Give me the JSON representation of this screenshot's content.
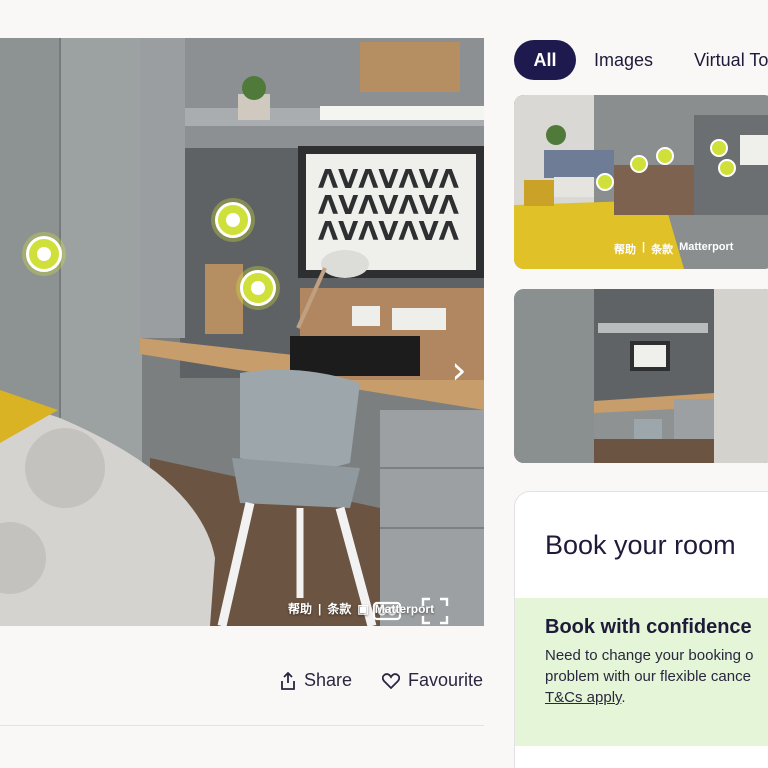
{
  "viewer": {
    "next_arrow": "›",
    "footer": {
      "help": "帮助",
      "separator": "|",
      "terms": "条款",
      "brand": "Matterport"
    }
  },
  "actions": {
    "share_label": "Share",
    "favourite_label": "Favourite"
  },
  "tabs": [
    {
      "label": "All",
      "active": true
    },
    {
      "label": "Images",
      "active": false
    },
    {
      "label": "Virtual To",
      "active": false
    }
  ],
  "thumbnails": [
    {
      "footer": {
        "help": "帮助",
        "separator": "|",
        "terms": "条款",
        "brand": "Matterport"
      }
    }
  ],
  "booking": {
    "title": "Book your room",
    "confidence_title": "Book with confidence",
    "line1": "Need to change your booking o",
    "line2": "problem with our flexible cance",
    "terms_link": "T&Cs apply",
    "terms_after": "."
  },
  "colors": {
    "accent": "#cfe03a",
    "navy": "#1f1a4d",
    "confidence_bg": "#e5f5d7"
  }
}
